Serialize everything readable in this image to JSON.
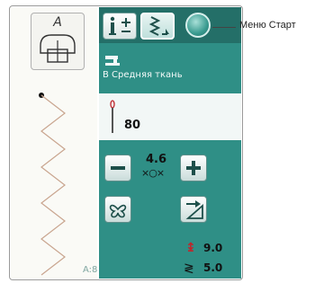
{
  "preview": {
    "foot_letter": "A",
    "stitch_code": "A:8"
  },
  "toolbar": {
    "info_icon": "info-plus-icon",
    "stitch_icon": "stitch-settings-icon",
    "start_menu_icon": "start-menu-orb-icon"
  },
  "fabric": {
    "label": "В Средняя ткань",
    "icon": "sewing-machine-icon"
  },
  "needle": {
    "icon": "needle-icon",
    "value": "80"
  },
  "stitch_width": {
    "value": "4.6",
    "symbol": "×○×"
  },
  "stitch_length": {
    "value": "9.0"
  },
  "stitch_density": {
    "value": "5.0"
  },
  "callout": {
    "label": "Меню Старт"
  },
  "colors": {
    "panel": "#2f8f86",
    "stitch_line": "#c9a58f"
  }
}
